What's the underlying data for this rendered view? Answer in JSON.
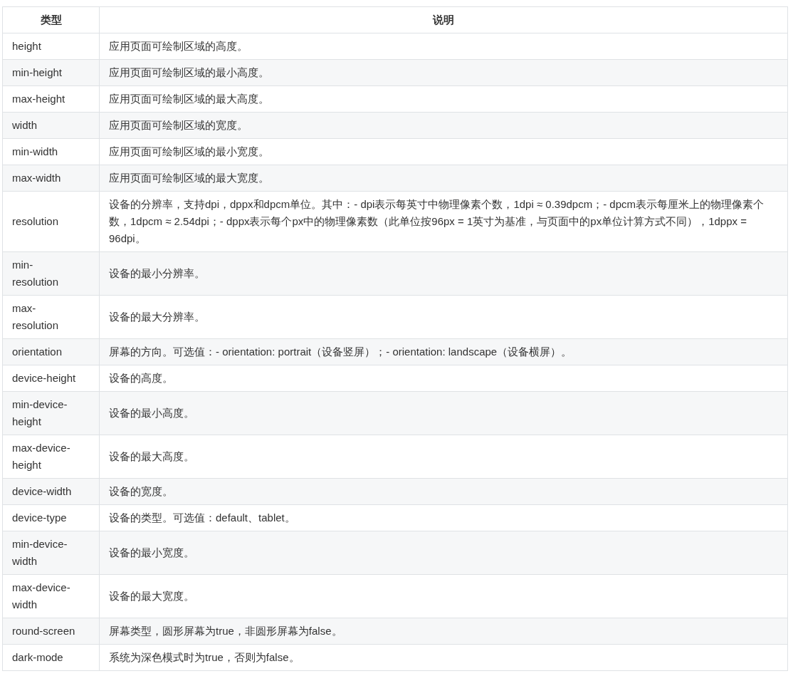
{
  "table": {
    "columns": [
      "类型",
      "说明"
    ],
    "rows": [
      {
        "type": "height",
        "description": "应用页面可绘制区域的高度。"
      },
      {
        "type": "min-height",
        "description": "应用页面可绘制区域的最小高度。"
      },
      {
        "type": "max-height",
        "description": "应用页面可绘制区域的最大高度。"
      },
      {
        "type": "width",
        "description": "应用页面可绘制区域的宽度。"
      },
      {
        "type": "min-width",
        "description": "应用页面可绘制区域的最小宽度。"
      },
      {
        "type": "max-width",
        "description": "应用页面可绘制区域的最大宽度。"
      },
      {
        "type": "resolution",
        "description": "设备的分辨率，支持dpi，dppx和dpcm单位。其中：- dpi表示每英寸中物理像素个数，1dpi ≈ 0.39dpcm；- dpcm表示每厘米上的物理像素个数，1dpcm ≈ 2.54dpi；- dppx表示每个px中的物理像素数（此单位按96px = 1英寸为基准，与页面中的px单位计算方式不同），1dppx = 96dpi。"
      },
      {
        "type": "min-resolution",
        "description": "设备的最小分辨率。"
      },
      {
        "type": "max-resolution",
        "description": "设备的最大分辨率。"
      },
      {
        "type": "orientation",
        "description": "屏幕的方向。可选值：- orientation: portrait（设备竖屏）；- orientation: landscape（设备横屏）。"
      },
      {
        "type": "device-height",
        "description": "设备的高度。"
      },
      {
        "type": "min-device-height",
        "description": "设备的最小高度。"
      },
      {
        "type": "max-device-height",
        "description": "设备的最大高度。"
      },
      {
        "type": "device-width",
        "description": "设备的宽度。"
      },
      {
        "type": "device-type",
        "description": "设备的类型。可选值：default、tablet。"
      },
      {
        "type": "min-device-width",
        "description": "设备的最小宽度。"
      },
      {
        "type": "max-device-width",
        "description": "设备的最大宽度。"
      },
      {
        "type": "round-screen",
        "description": "屏幕类型，圆形屏幕为true，非圆形屏幕为false。"
      },
      {
        "type": "dark-mode",
        "description": "系统为深色模式时为true，否则为false。"
      }
    ]
  }
}
